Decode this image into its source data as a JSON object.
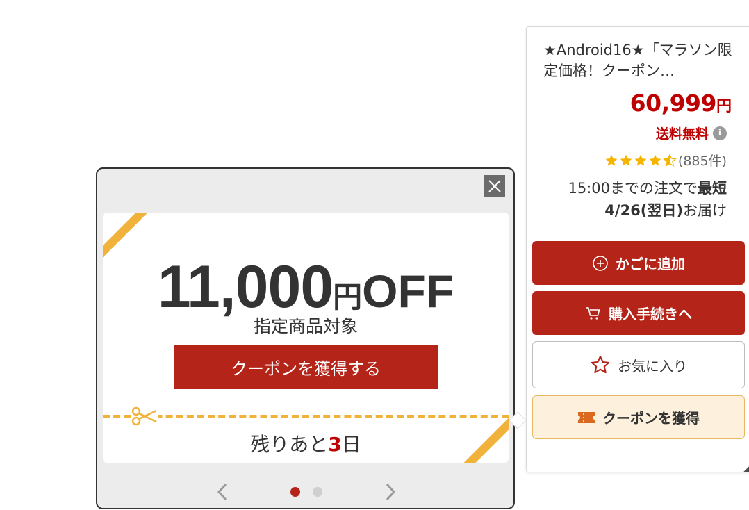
{
  "product": {
    "title": "★Android16★「マラソン限定価格！クーポン…",
    "price": "60,999",
    "price_unit": "円",
    "shipping": "送料無料",
    "info_icon_glyph": "i",
    "rating": 4.5,
    "review_count": "(885件)",
    "delivery": {
      "prefix": "15:00までの注文で",
      "emphasis": "最短4/26(翌日)",
      "suffix": "お届け"
    }
  },
  "buttons": {
    "add_to_cart": "かごに追加",
    "checkout": "購入手続きへ",
    "favorite": "お気に入り",
    "get_coupon": "クーポンを獲得"
  },
  "popup": {
    "amount": "11,000",
    "amount_unit": "円",
    "amount_suffix": "OFF",
    "target": "指定商品対象",
    "get_button": "クーポンを獲得する",
    "remaining_prefix": "残りあと",
    "remaining_days": "3",
    "remaining_suffix": "日",
    "pages": 2,
    "current_page": 1
  },
  "colors": {
    "brand_red": "#b52418",
    "price_red": "#bf0000",
    "ribbon_gold": "#f0b23a",
    "star_gold": "#f5b400",
    "coupon_bg": "#fdf0dc"
  },
  "icons": [
    "close-icon",
    "plus-circle-icon",
    "cart-icon",
    "star-outline-icon",
    "ticket-icon",
    "scissors-icon",
    "info-icon",
    "chevron-left-icon",
    "chevron-right-icon"
  ]
}
